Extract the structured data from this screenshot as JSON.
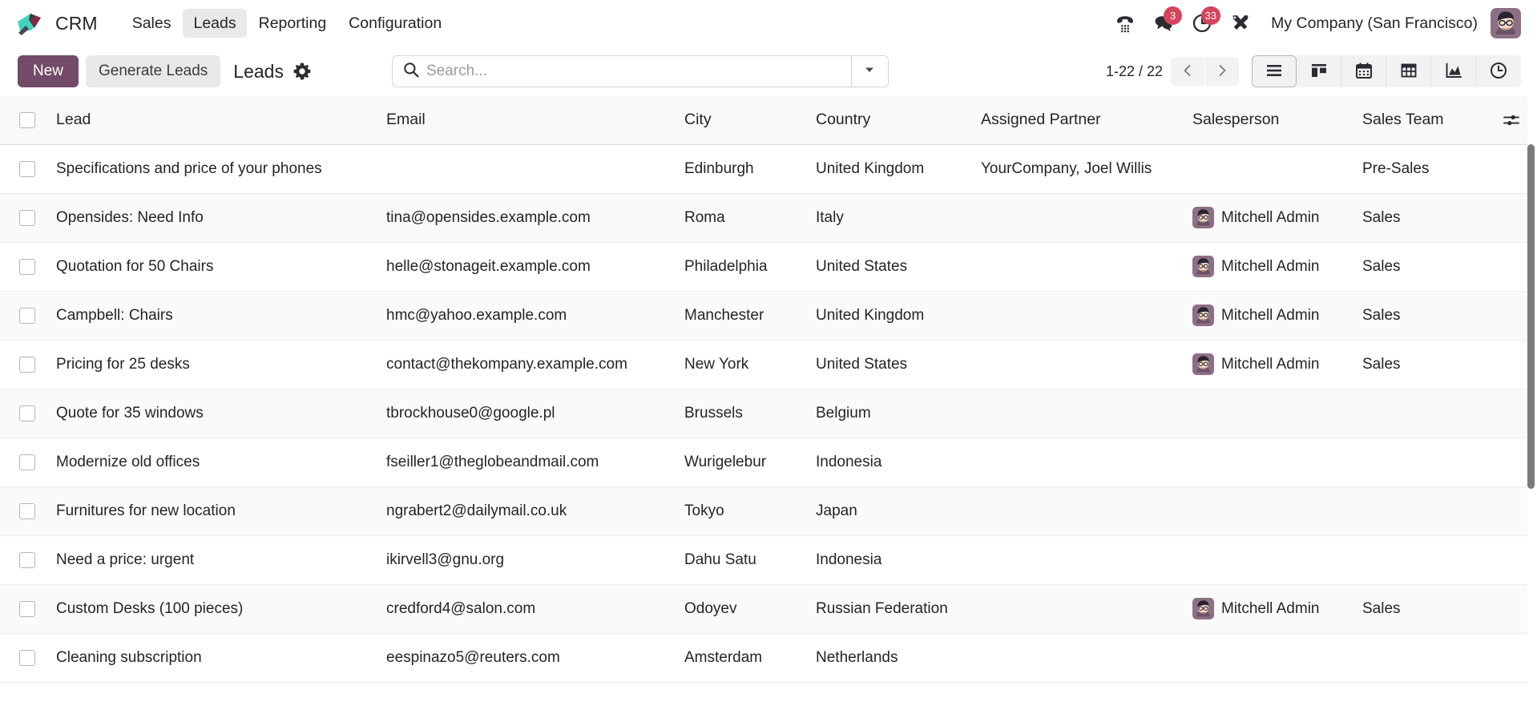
{
  "navbar": {
    "brand": "CRM",
    "logo_icon": "crm-logo-icon",
    "menu": [
      {
        "label": "Sales",
        "active": false
      },
      {
        "label": "Leads",
        "active": true
      },
      {
        "label": "Reporting",
        "active": false
      },
      {
        "label": "Configuration",
        "active": false
      }
    ],
    "systray": [
      {
        "name": "voip-phone-icon",
        "badge": null
      },
      {
        "name": "messages-icon",
        "badge": "3"
      },
      {
        "name": "activities-clock-icon",
        "badge": "33"
      },
      {
        "name": "debug-tools-icon",
        "badge": null
      }
    ],
    "company": "My Company (San Francisco)",
    "avatar_icon": "user-avatar"
  },
  "control_panel": {
    "new_label": "New",
    "generate_leads_label": "Generate Leads",
    "breadcrumb_title": "Leads",
    "gear_icon": "gear-icon",
    "search": {
      "placeholder": "Search...",
      "value": "",
      "icon": "search-icon",
      "dropdown_icon": "caret-down-icon"
    },
    "pager": {
      "value": "1-22 / 22",
      "previous_icon": "chevron-left-icon",
      "next_icon": "chevron-right-icon"
    },
    "views": [
      {
        "name": "list",
        "icon": "list-view-icon",
        "active": true
      },
      {
        "name": "kanban",
        "icon": "kanban-view-icon",
        "active": false
      },
      {
        "name": "calendar",
        "icon": "calendar-view-icon",
        "active": false
      },
      {
        "name": "pivot",
        "icon": "pivot-view-icon",
        "active": false
      },
      {
        "name": "graph",
        "icon": "graph-view-icon",
        "active": false
      },
      {
        "name": "activity",
        "icon": "activity-view-icon",
        "active": false
      }
    ]
  },
  "list": {
    "columns": [
      "Lead",
      "Email",
      "City",
      "Country",
      "Assigned Partner",
      "Salesperson",
      "Sales Team"
    ],
    "optional_columns_icon": "column-settings-icon",
    "rows": [
      {
        "lead": "Specifications and price of your phones",
        "email": "",
        "city": "Edinburgh",
        "country": "United Kingdom",
        "partner": "YourCompany, Joel Willis",
        "salesperson": "",
        "has_avatar": false,
        "team": "Pre-Sales"
      },
      {
        "lead": "Opensides: Need Info",
        "email": "tina@opensides.example.com",
        "city": "Roma",
        "country": "Italy",
        "partner": "",
        "salesperson": "Mitchell Admin",
        "has_avatar": true,
        "team": "Sales"
      },
      {
        "lead": "Quotation for 50 Chairs",
        "email": "helle@stonageit.example.com",
        "city": "Philadelphia",
        "country": "United States",
        "partner": "",
        "salesperson": "Mitchell Admin",
        "has_avatar": true,
        "team": "Sales"
      },
      {
        "lead": "Campbell: Chairs",
        "email": "hmc@yahoo.example.com",
        "city": "Manchester",
        "country": "United Kingdom",
        "partner": "",
        "salesperson": "Mitchell Admin",
        "has_avatar": true,
        "team": "Sales"
      },
      {
        "lead": "Pricing for 25 desks",
        "email": "contact@thekompany.example.com",
        "city": "New York",
        "country": "United States",
        "partner": "",
        "salesperson": "Mitchell Admin",
        "has_avatar": true,
        "team": "Sales"
      },
      {
        "lead": "Quote for 35 windows",
        "email": "tbrockhouse0@google.pl",
        "city": "Brussels",
        "country": "Belgium",
        "partner": "",
        "salesperson": "",
        "has_avatar": false,
        "team": ""
      },
      {
        "lead": "Modernize old offices",
        "email": "fseiller1@theglobeandmail.com",
        "city": "Wurigelebur",
        "country": "Indonesia",
        "partner": "",
        "salesperson": "",
        "has_avatar": false,
        "team": ""
      },
      {
        "lead": "Furnitures for new location",
        "email": "ngrabert2@dailymail.co.uk",
        "city": "Tokyo",
        "country": "Japan",
        "partner": "",
        "salesperson": "",
        "has_avatar": false,
        "team": ""
      },
      {
        "lead": "Need a price: urgent",
        "email": "ikirvell3@gnu.org",
        "city": "Dahu Satu",
        "country": "Indonesia",
        "partner": "",
        "salesperson": "",
        "has_avatar": false,
        "team": ""
      },
      {
        "lead": "Custom Desks (100 pieces)",
        "email": "credford4@salon.com",
        "city": "Odoyev",
        "country": "Russian Federation",
        "partner": "",
        "salesperson": "Mitchell Admin",
        "has_avatar": true,
        "team": "Sales"
      },
      {
        "lead": "Cleaning subscription",
        "email": "eespinazo5@reuters.com",
        "city": "Amsterdam",
        "country": "Netherlands",
        "partner": "",
        "salesperson": "",
        "has_avatar": false,
        "team": ""
      }
    ]
  },
  "colors": {
    "brand_primary": "#714b67",
    "badge_red": "#d6435b",
    "logo_teal": "#3fd3c0",
    "header_bg": "#f9f9f9",
    "row_alt_bg": "#fafafa"
  }
}
